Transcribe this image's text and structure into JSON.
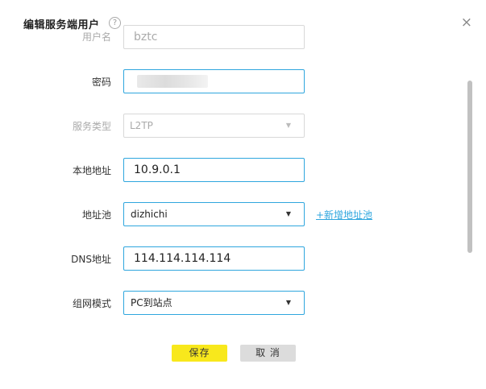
{
  "dialog": {
    "title": "编辑服务端用户",
    "help_glyph": "?",
    "close_glyph": "×"
  },
  "form": {
    "username": {
      "label": "用户名",
      "value": "bztc"
    },
    "password": {
      "label": "密码"
    },
    "service_type": {
      "label": "服务类型",
      "value": "L2TP"
    },
    "local_address": {
      "label": "本地地址",
      "value": "10.9.0.1"
    },
    "address_pool": {
      "label": "地址池",
      "value": "dizhichi",
      "add_link": "+新增地址池"
    },
    "dns_address": {
      "label": "DNS地址",
      "value": "114.114.114.114"
    },
    "network_mode": {
      "label": "组网模式",
      "value": "PC到站点"
    }
  },
  "buttons": {
    "save": "保存",
    "cancel": "取 消"
  },
  "colors": {
    "accent": "#2fa6de",
    "save_button": "#f8e81c",
    "cancel_button": "#dcdcdc"
  }
}
